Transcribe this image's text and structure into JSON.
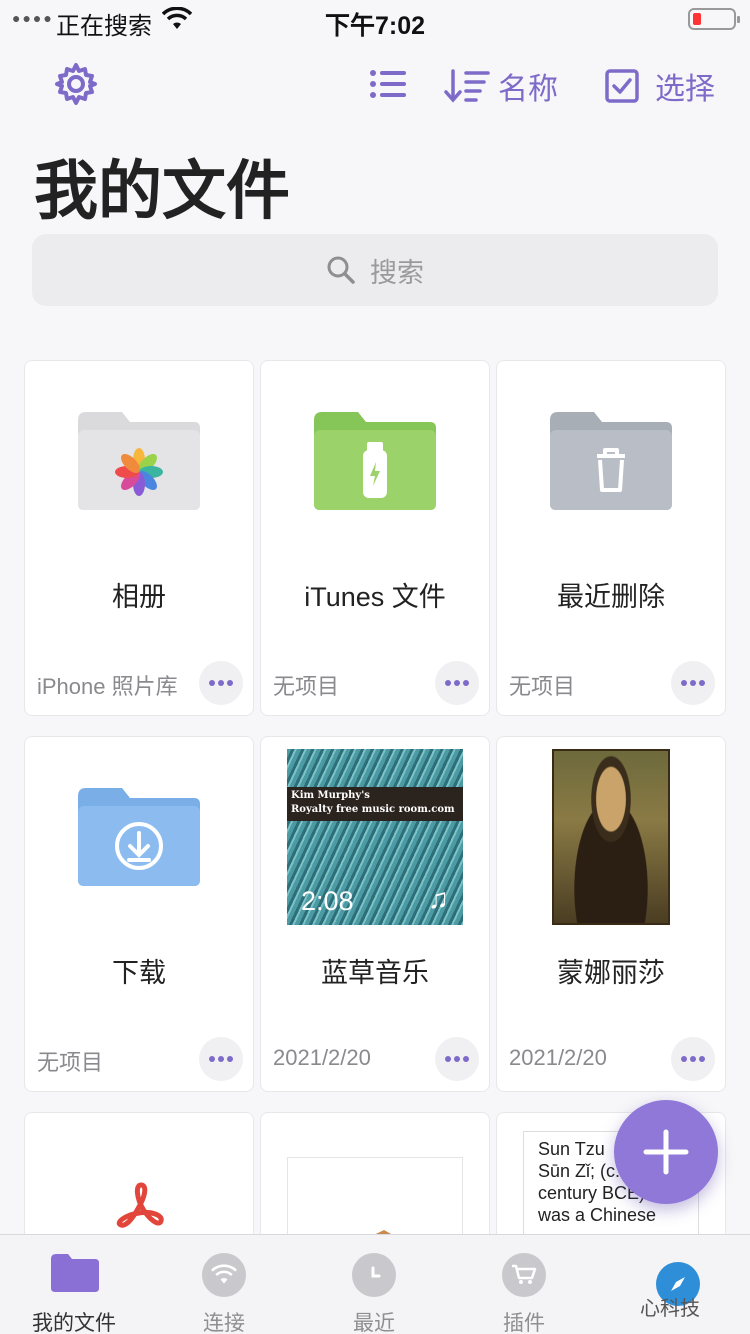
{
  "status_bar": {
    "carrier": "正在搜索",
    "time": "下午7:02"
  },
  "toolbar": {
    "sort_label": "名称",
    "select_label": "选择"
  },
  "page_title": "我的文件",
  "search": {
    "placeholder": "搜索"
  },
  "items": [
    {
      "name": "相册",
      "meta": "iPhone 照片库",
      "icon": "photos-folder-icon"
    },
    {
      "name": "iTunes 文件",
      "meta": "无项目",
      "icon": "itunes-folder-icon"
    },
    {
      "name": "最近删除",
      "meta": "无项目",
      "icon": "trash-folder-icon"
    },
    {
      "name": "下载",
      "meta": "无项目",
      "icon": "download-folder-icon"
    },
    {
      "name": "蓝草音乐",
      "meta": "2021/2/20",
      "icon": "music-thumbnail",
      "duration": "2:08",
      "banner_line1": "Kim Murphy's",
      "banner_line2": "Royalty free music room.com"
    },
    {
      "name": "蒙娜丽莎",
      "meta": "2021/2/20",
      "icon": "painting-thumbnail"
    },
    {
      "icon": "pdf-icon"
    },
    {
      "icon": "document-thumbnail"
    },
    {
      "icon": "text-thumbnail",
      "preview": "Sun Tzu\nSūn Zǐ; (c.\ncentury BCE)\nwas a Chinese"
    }
  ],
  "tabs": [
    {
      "label": "我的文件",
      "icon": "folder-icon",
      "active": true
    },
    {
      "label": "连接",
      "icon": "wifi-icon",
      "active": false
    },
    {
      "label": "最近",
      "icon": "clock-icon",
      "active": false
    },
    {
      "label": "插件",
      "icon": "cart-icon",
      "active": false
    }
  ],
  "watermark": "心科技",
  "colors": {
    "accent": "#7e6bc9",
    "fab": "#8f78d8",
    "itunes_folder": "#9bd26a",
    "download_folder": "#8cbcef",
    "trash_folder": "#b9bec6"
  }
}
